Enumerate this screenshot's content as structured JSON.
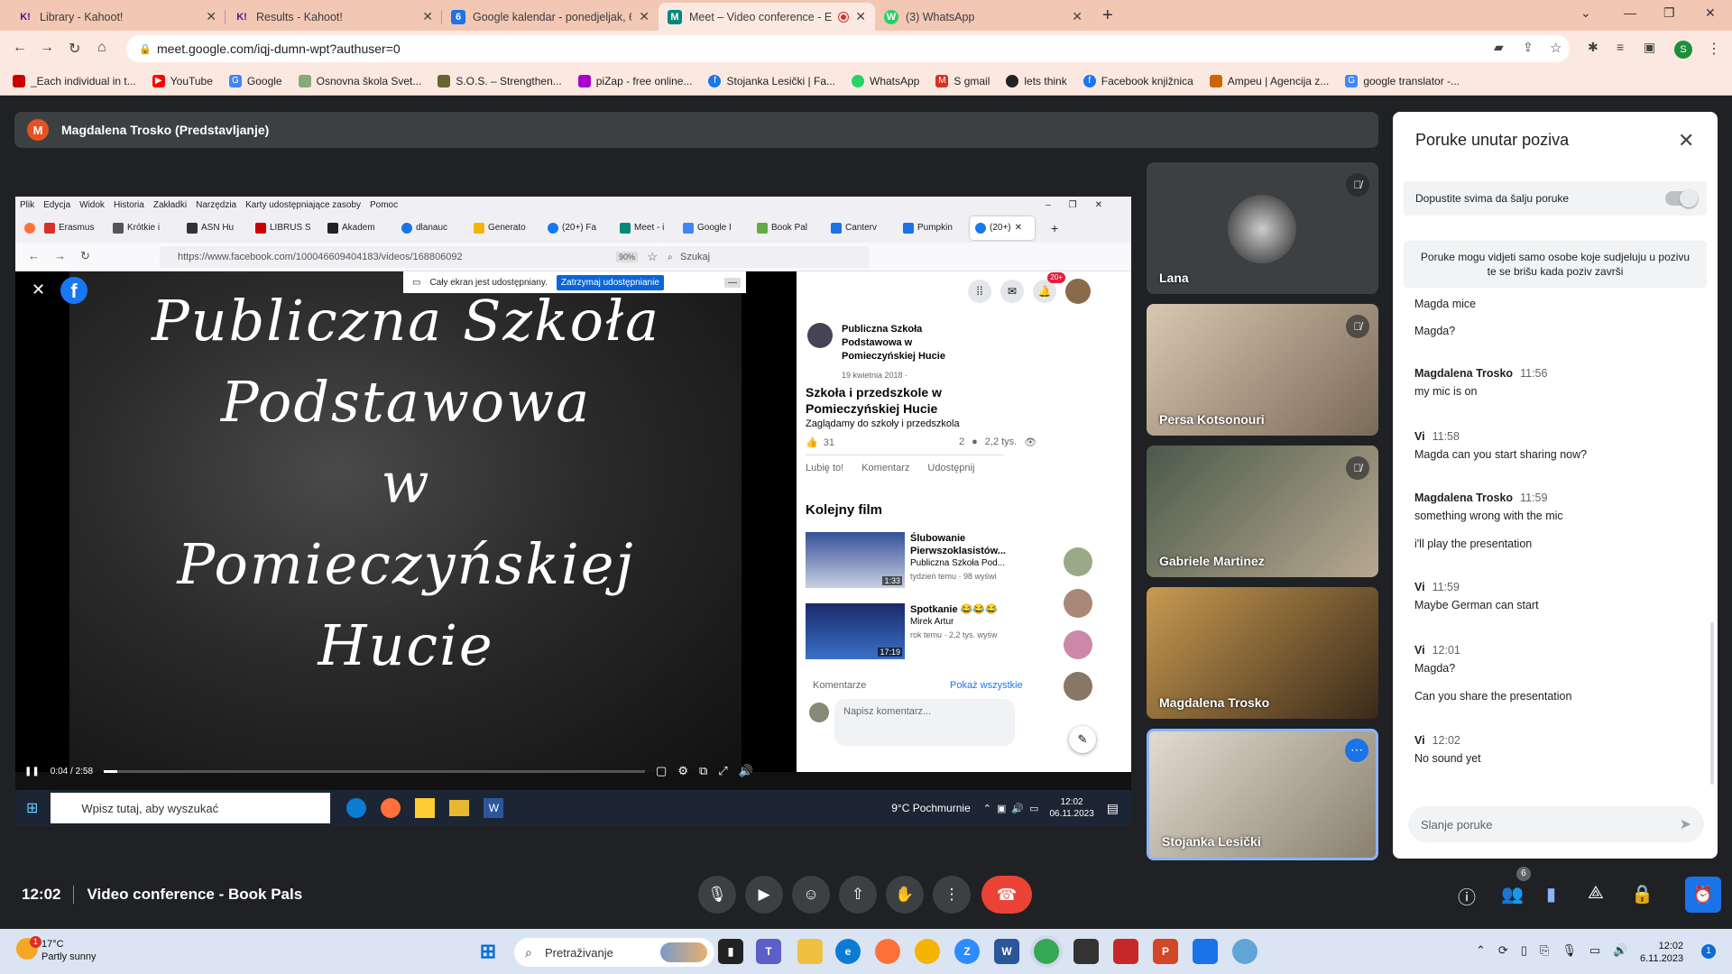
{
  "tabs": [
    {
      "title": "Library - Kahoot!",
      "icon": "K!",
      "color": "#46178f"
    },
    {
      "title": "Results - Kahoot!",
      "icon": "K!",
      "color": "#46178f"
    },
    {
      "title": "Google kalendar - ponedjeljak, 6",
      "icon": "6",
      "color": "#1a73e8"
    },
    {
      "title": "Meet – Video conference - E",
      "icon": "M",
      "color": "#00897b"
    },
    {
      "title": "(3) WhatsApp",
      "icon": "W",
      "color": "#25d366"
    }
  ],
  "url": "meet.google.com/iqj-dumn-wpt?authuser=0",
  "bookmarks": [
    {
      "label": "_Each individual in t...",
      "color": "#c00"
    },
    {
      "label": "YouTube",
      "color": "#f00"
    },
    {
      "label": "Google",
      "color": "#4285f4"
    },
    {
      "label": "Osnovna škola Svet...",
      "color": "#8a7"
    },
    {
      "label": "S.O.S. – Strengthen...",
      "color": "#663"
    },
    {
      "label": "piZap - free online...",
      "color": "#a0c"
    },
    {
      "label": "Stojanka Lesički | Fa...",
      "color": "#1877f2"
    },
    {
      "label": "WhatsApp",
      "color": "#25d366"
    },
    {
      "label": "S gmail",
      "color": "#d93025"
    },
    {
      "label": "lets think",
      "color": "#222"
    },
    {
      "label": "Facebook knjižnica",
      "color": "#1877f2"
    },
    {
      "label": "Ampeu | Agencija z...",
      "color": "#c60"
    },
    {
      "label": "google translator -...",
      "color": "#4285f4"
    }
  ],
  "presenter": {
    "initial": "M",
    "label": "Magdalena Trosko (Predstavljanje)"
  },
  "shared": {
    "menu": [
      "Plik",
      "Edycja",
      "Widok",
      "Historia",
      "Zakładki",
      "Narzędzia",
      "Karty udostępniające zasoby",
      "Pomoc"
    ],
    "fftabs": [
      "Erasmus",
      "Krótkie i",
      "ASN Hu",
      "LIBRUS S",
      "Akadem",
      "dlanauc",
      "Generato",
      "(20+) Fa",
      "Meet - i",
      "Google I",
      "Book Pal",
      "Canterv",
      "Pumpkin",
      "(20+)"
    ],
    "url": "https://www.facebook.com/100046609404183/videos/168806092",
    "zoom": "90%",
    "search_placeholder": "Szukaj",
    "sharing_text": "Cały ekran jest udostępniany.",
    "stop_sharing": "Zatrzymaj udostępnianie",
    "video_lines": [
      "Publiczna Szkoła",
      "Podstawowa",
      "w",
      "Pomieczyńskiej",
      "Hucie"
    ],
    "video_time": "0:04 / 2:58",
    "video_progress": 0.025,
    "fb": {
      "page_name": "Publiczna Szkoła Podstawowa w Pomieczyńskiej Hucie",
      "date": "19 kwietnia 2018 ·",
      "post_title": "Szkoła i przedszkole w Pomieczyńskiej Hucie",
      "post_sub": "Zaglądamy do szkoły i przedszkola",
      "reactions": "31",
      "comments_count": "2",
      "views": "2,2 tys.",
      "like": "Lubię to!",
      "comment": "Komentarz",
      "share": "Udostępnij",
      "next_film": "Kolejny film",
      "videos": [
        {
          "title": "Ślubowanie Pierwszoklasistów...",
          "author": "Publiczna Szkoła Pod...",
          "meta": "tydzień temu · 98 wyświ",
          "duration": "1:33"
        },
        {
          "title": "Spotkanie 😂😂😂",
          "author": "Mirek Artur",
          "meta": "rok temu · 2,2 tys. wyśw",
          "duration": "17:19"
        }
      ],
      "comments_label": "Komentarze",
      "show_all": "Pokaż wszystkie",
      "comment_placeholder": "Napisz komentarz...",
      "notif_badge": "20+"
    },
    "taskbar": {
      "search": "Wpisz tutaj, aby wyszukać",
      "weather": "9°C  Pochmurnie",
      "time": "12:02",
      "date": "06.11.2023"
    }
  },
  "participants": [
    {
      "name": "Lana",
      "muted": true,
      "bg": "#3c4043"
    },
    {
      "name": "Persa Kotsonouri",
      "muted": true,
      "bg": "#a08870"
    },
    {
      "name": "Gabriele Martinez",
      "muted": true,
      "bg": "#6a6a5c"
    },
    {
      "name": "Magdalena Trosko",
      "muted": false,
      "bg": "#8a6a3a"
    },
    {
      "name": "Stojanka Lesički",
      "muted": false,
      "bg": "#c8c4bc"
    }
  ],
  "chat": {
    "title": "Poruke unutar poziva",
    "allow_label": "Dopustite svima da šalju poruke",
    "notice": "Poruke mogu vidjeti samo osobe koje sudjeluju u pozivu te se brišu kada poziv završi",
    "messages": [
      {
        "who": "",
        "time": "",
        "text": "Magda mice"
      },
      {
        "who": "",
        "time": "",
        "text": "Magda?"
      },
      {
        "who": "Magdalena Trosko",
        "time": "11:56",
        "text": "my mic is on"
      },
      {
        "who": "Vi",
        "time": "11:58",
        "text": "Magda can you start sharing now?"
      },
      {
        "who": "Magdalena Trosko",
        "time": "11:59",
        "text": "something wrong with the mic"
      },
      {
        "who": "",
        "time": "",
        "text": "i'll play the presentation"
      },
      {
        "who": "Vi",
        "time": "11:59",
        "text": "Maybe German can start"
      },
      {
        "who": "Vi",
        "time": "12:01",
        "text": "Magda?"
      },
      {
        "who": "",
        "time": "",
        "text": "Can you share the presentation"
      },
      {
        "who": "Vi",
        "time": "12:02",
        "text": "No sound yet"
      }
    ],
    "input_placeholder": "Slanje poruke"
  },
  "meeting": {
    "time": "12:02",
    "title": "Video conference - Book Pals",
    "people_count": "6"
  },
  "win": {
    "weather_temp": "17°C",
    "weather_desc": "Partly sunny",
    "weather_badge": "1",
    "search": "Pretraživanje",
    "time": "12:02",
    "date": "6.11.2023",
    "notif": "1"
  }
}
